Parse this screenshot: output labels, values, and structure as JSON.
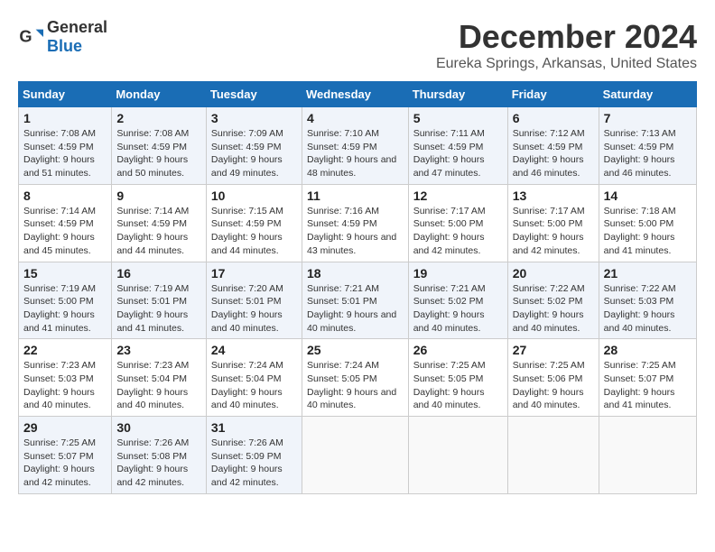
{
  "logo": {
    "text_general": "General",
    "text_blue": "Blue"
  },
  "title": "December 2024",
  "subtitle": "Eureka Springs, Arkansas, United States",
  "days_of_week": [
    "Sunday",
    "Monday",
    "Tuesday",
    "Wednesday",
    "Thursday",
    "Friday",
    "Saturday"
  ],
  "weeks": [
    [
      {
        "day": "1",
        "sunrise": "Sunrise: 7:08 AM",
        "sunset": "Sunset: 4:59 PM",
        "daylight": "Daylight: 9 hours and 51 minutes."
      },
      {
        "day": "2",
        "sunrise": "Sunrise: 7:08 AM",
        "sunset": "Sunset: 4:59 PM",
        "daylight": "Daylight: 9 hours and 50 minutes."
      },
      {
        "day": "3",
        "sunrise": "Sunrise: 7:09 AM",
        "sunset": "Sunset: 4:59 PM",
        "daylight": "Daylight: 9 hours and 49 minutes."
      },
      {
        "day": "4",
        "sunrise": "Sunrise: 7:10 AM",
        "sunset": "Sunset: 4:59 PM",
        "daylight": "Daylight: 9 hours and 48 minutes."
      },
      {
        "day": "5",
        "sunrise": "Sunrise: 7:11 AM",
        "sunset": "Sunset: 4:59 PM",
        "daylight": "Daylight: 9 hours and 47 minutes."
      },
      {
        "day": "6",
        "sunrise": "Sunrise: 7:12 AM",
        "sunset": "Sunset: 4:59 PM",
        "daylight": "Daylight: 9 hours and 46 minutes."
      },
      {
        "day": "7",
        "sunrise": "Sunrise: 7:13 AM",
        "sunset": "Sunset: 4:59 PM",
        "daylight": "Daylight: 9 hours and 46 minutes."
      }
    ],
    [
      {
        "day": "8",
        "sunrise": "Sunrise: 7:14 AM",
        "sunset": "Sunset: 4:59 PM",
        "daylight": "Daylight: 9 hours and 45 minutes."
      },
      {
        "day": "9",
        "sunrise": "Sunrise: 7:14 AM",
        "sunset": "Sunset: 4:59 PM",
        "daylight": "Daylight: 9 hours and 44 minutes."
      },
      {
        "day": "10",
        "sunrise": "Sunrise: 7:15 AM",
        "sunset": "Sunset: 4:59 PM",
        "daylight": "Daylight: 9 hours and 44 minutes."
      },
      {
        "day": "11",
        "sunrise": "Sunrise: 7:16 AM",
        "sunset": "Sunset: 4:59 PM",
        "daylight": "Daylight: 9 hours and 43 minutes."
      },
      {
        "day": "12",
        "sunrise": "Sunrise: 7:17 AM",
        "sunset": "Sunset: 5:00 PM",
        "daylight": "Daylight: 9 hours and 42 minutes."
      },
      {
        "day": "13",
        "sunrise": "Sunrise: 7:17 AM",
        "sunset": "Sunset: 5:00 PM",
        "daylight": "Daylight: 9 hours and 42 minutes."
      },
      {
        "day": "14",
        "sunrise": "Sunrise: 7:18 AM",
        "sunset": "Sunset: 5:00 PM",
        "daylight": "Daylight: 9 hours and 41 minutes."
      }
    ],
    [
      {
        "day": "15",
        "sunrise": "Sunrise: 7:19 AM",
        "sunset": "Sunset: 5:00 PM",
        "daylight": "Daylight: 9 hours and 41 minutes."
      },
      {
        "day": "16",
        "sunrise": "Sunrise: 7:19 AM",
        "sunset": "Sunset: 5:01 PM",
        "daylight": "Daylight: 9 hours and 41 minutes."
      },
      {
        "day": "17",
        "sunrise": "Sunrise: 7:20 AM",
        "sunset": "Sunset: 5:01 PM",
        "daylight": "Daylight: 9 hours and 40 minutes."
      },
      {
        "day": "18",
        "sunrise": "Sunrise: 7:21 AM",
        "sunset": "Sunset: 5:01 PM",
        "daylight": "Daylight: 9 hours and 40 minutes."
      },
      {
        "day": "19",
        "sunrise": "Sunrise: 7:21 AM",
        "sunset": "Sunset: 5:02 PM",
        "daylight": "Daylight: 9 hours and 40 minutes."
      },
      {
        "day": "20",
        "sunrise": "Sunrise: 7:22 AM",
        "sunset": "Sunset: 5:02 PM",
        "daylight": "Daylight: 9 hours and 40 minutes."
      },
      {
        "day": "21",
        "sunrise": "Sunrise: 7:22 AM",
        "sunset": "Sunset: 5:03 PM",
        "daylight": "Daylight: 9 hours and 40 minutes."
      }
    ],
    [
      {
        "day": "22",
        "sunrise": "Sunrise: 7:23 AM",
        "sunset": "Sunset: 5:03 PM",
        "daylight": "Daylight: 9 hours and 40 minutes."
      },
      {
        "day": "23",
        "sunrise": "Sunrise: 7:23 AM",
        "sunset": "Sunset: 5:04 PM",
        "daylight": "Daylight: 9 hours and 40 minutes."
      },
      {
        "day": "24",
        "sunrise": "Sunrise: 7:24 AM",
        "sunset": "Sunset: 5:04 PM",
        "daylight": "Daylight: 9 hours and 40 minutes."
      },
      {
        "day": "25",
        "sunrise": "Sunrise: 7:24 AM",
        "sunset": "Sunset: 5:05 PM",
        "daylight": "Daylight: 9 hours and 40 minutes."
      },
      {
        "day": "26",
        "sunrise": "Sunrise: 7:25 AM",
        "sunset": "Sunset: 5:05 PM",
        "daylight": "Daylight: 9 hours and 40 minutes."
      },
      {
        "day": "27",
        "sunrise": "Sunrise: 7:25 AM",
        "sunset": "Sunset: 5:06 PM",
        "daylight": "Daylight: 9 hours and 40 minutes."
      },
      {
        "day": "28",
        "sunrise": "Sunrise: 7:25 AM",
        "sunset": "Sunset: 5:07 PM",
        "daylight": "Daylight: 9 hours and 41 minutes."
      }
    ],
    [
      {
        "day": "29",
        "sunrise": "Sunrise: 7:25 AM",
        "sunset": "Sunset: 5:07 PM",
        "daylight": "Daylight: 9 hours and 42 minutes."
      },
      {
        "day": "30",
        "sunrise": "Sunrise: 7:26 AM",
        "sunset": "Sunset: 5:08 PM",
        "daylight": "Daylight: 9 hours and 42 minutes."
      },
      {
        "day": "31",
        "sunrise": "Sunrise: 7:26 AM",
        "sunset": "Sunset: 5:09 PM",
        "daylight": "Daylight: 9 hours and 42 minutes."
      },
      null,
      null,
      null,
      null
    ]
  ]
}
